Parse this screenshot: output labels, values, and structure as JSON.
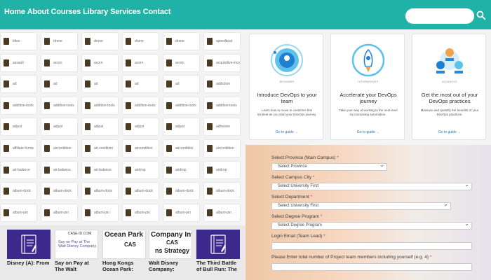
{
  "nav": {
    "links": [
      "Home",
      "About",
      "Courses",
      "Library",
      "Services",
      "Contact"
    ],
    "search_placeholder": ""
  },
  "grid": {
    "rows": [
      [
        "titles",
        "drone",
        "drone",
        "drone",
        "drone",
        "speedboat"
      ],
      [
        "assault",
        "acorn",
        "acorn",
        "acorn",
        "acorn",
        "acquisitive-incorporated"
      ],
      [
        "ad",
        "ad",
        "ad",
        "ad",
        "ad",
        "addiction"
      ],
      [
        "addition-tools",
        "addition-tools",
        "addition-tools",
        "addition-tools",
        "addition-tools",
        "addition-tools"
      ],
      [
        "adjust",
        "adjust",
        "adjust",
        "adjust",
        "adjust",
        "adhesive"
      ],
      [
        "affiliate-forms",
        "aircondition",
        "air-condition",
        "aircondition",
        "aircondition",
        "aircondition"
      ],
      [
        "air-balance",
        "air-balance",
        "air-balance",
        "airdrop",
        "airdrop",
        "airdrop"
      ],
      [
        "album-dock",
        "album-dock",
        "album-dock",
        "album-dock",
        "album-dock",
        "album-dock"
      ],
      [
        "album-pin",
        "album-pin",
        "album-pin",
        "album-pin",
        "album-pin",
        "album-pin"
      ]
    ]
  },
  "books": [
    {
      "title": "Disney (A): From",
      "cover": "notebook"
    },
    {
      "title": "Say on Pay at The Walt",
      "cover": "light",
      "cover_head": "CASE-ID.COM",
      "cover_text": "Say on Pay at The Walt Disney Company"
    },
    {
      "title": "Hong Kongs Ocean Park:",
      "cover": "light",
      "cover_big": "Ocean Park Tal",
      "cover_mid": "CAS"
    },
    {
      "title": "Walt Disney Company:",
      "cover": "light",
      "cover_big": "Company Inves",
      "cover_mid": "CAS",
      "cover_line2": "ns Strategy"
    },
    {
      "title": "The Third Battle of Bull Run: The",
      "cover": "notebook"
    }
  ],
  "cards": [
    {
      "kicker": "BEGINNER",
      "title": "Introduce DevOps to your team",
      "desc": "Learn how to move to customer-first mindset as you start your DevOps journey.",
      "link": "Go to guide →"
    },
    {
      "kicker": "INTERMEDIATE",
      "title": "Accelerate your DevOps journey",
      "desc": "Take your way of working to the next level by increasing automation.",
      "link": "Go to guide →"
    },
    {
      "kicker": "ADVANCED",
      "title": "Get the most out of your DevOps practices",
      "desc": "Measure and quantify the benefits of your DevOps practices.",
      "link": "Go to guide →"
    }
  ],
  "form": {
    "province_label": "Select Province (Main Campus)",
    "province_value": "Select Province",
    "city_label": "Select Campus City",
    "city_value": "Select University First",
    "dept_label": "Select Department",
    "dept_value": "Select University First",
    "degree_label": "Select Degree Program",
    "degree_value": "Select Degree Program",
    "email_label": "Login Email (Team Lead)",
    "members_label": "Please Enter total number of Project team members including yourself (e.g. 4)",
    "required_mark": "*"
  }
}
